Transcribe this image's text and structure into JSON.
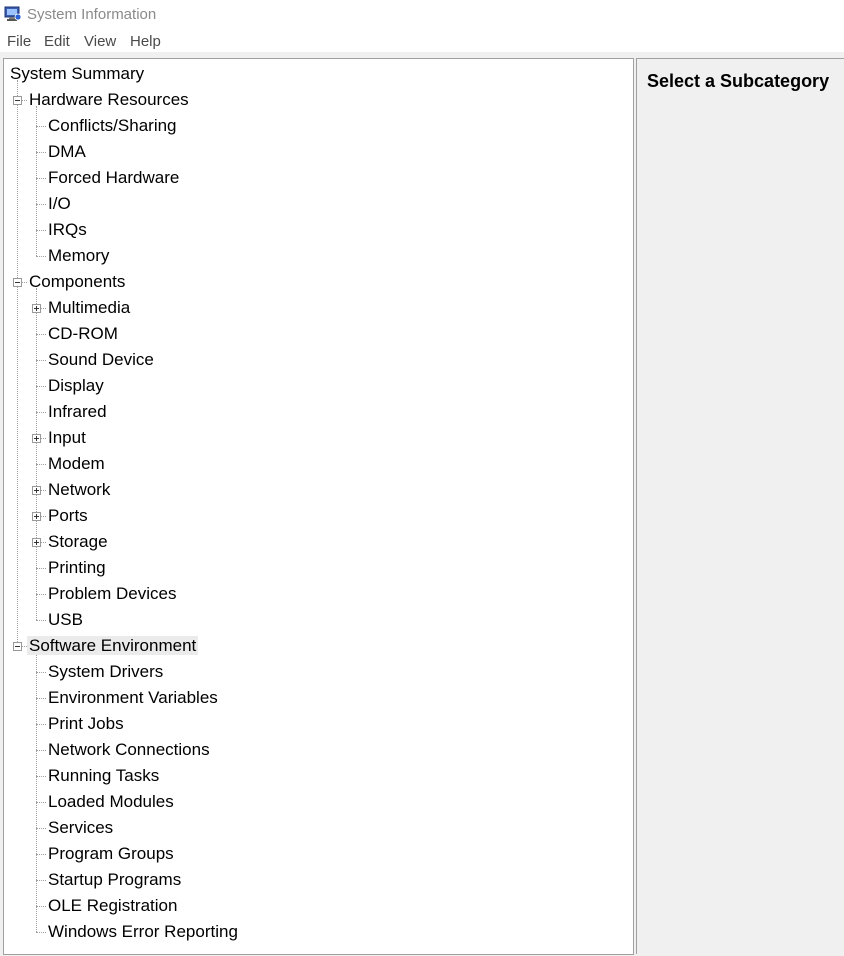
{
  "window": {
    "title": "System Information"
  },
  "menu": [
    "File",
    "Edit",
    "View",
    "Help"
  ],
  "tree": [
    {
      "label": "System Summary",
      "level": 0,
      "expander": ""
    },
    {
      "label": "Hardware Resources",
      "level": 1,
      "expander": "minus"
    },
    {
      "label": "Conflicts/Sharing",
      "level": 2,
      "expander": ""
    },
    {
      "label": "DMA",
      "level": 2,
      "expander": ""
    },
    {
      "label": "Forced Hardware",
      "level": 2,
      "expander": ""
    },
    {
      "label": "I/O",
      "level": 2,
      "expander": ""
    },
    {
      "label": "IRQs",
      "level": 2,
      "expander": ""
    },
    {
      "label": "Memory",
      "level": 2,
      "expander": ""
    },
    {
      "label": "Components",
      "level": 1,
      "expander": "minus"
    },
    {
      "label": "Multimedia",
      "level": 2,
      "expander": "plus"
    },
    {
      "label": "CD-ROM",
      "level": 2,
      "expander": ""
    },
    {
      "label": "Sound Device",
      "level": 2,
      "expander": ""
    },
    {
      "label": "Display",
      "level": 2,
      "expander": ""
    },
    {
      "label": "Infrared",
      "level": 2,
      "expander": ""
    },
    {
      "label": "Input",
      "level": 2,
      "expander": "plus"
    },
    {
      "label": "Modem",
      "level": 2,
      "expander": ""
    },
    {
      "label": "Network",
      "level": 2,
      "expander": "plus"
    },
    {
      "label": "Ports",
      "level": 2,
      "expander": "plus"
    },
    {
      "label": "Storage",
      "level": 2,
      "expander": "plus"
    },
    {
      "label": "Printing",
      "level": 2,
      "expander": ""
    },
    {
      "label": "Problem Devices",
      "level": 2,
      "expander": ""
    },
    {
      "label": "USB",
      "level": 2,
      "expander": ""
    },
    {
      "label": "Software Environment",
      "level": 1,
      "expander": "minus",
      "selected": true
    },
    {
      "label": "System Drivers",
      "level": 2,
      "expander": ""
    },
    {
      "label": "Environment Variables",
      "level": 2,
      "expander": ""
    },
    {
      "label": "Print Jobs",
      "level": 2,
      "expander": ""
    },
    {
      "label": "Network Connections",
      "level": 2,
      "expander": ""
    },
    {
      "label": "Running Tasks",
      "level": 2,
      "expander": ""
    },
    {
      "label": "Loaded Modules",
      "level": 2,
      "expander": ""
    },
    {
      "label": "Services",
      "level": 2,
      "expander": ""
    },
    {
      "label": "Program Groups",
      "level": 2,
      "expander": ""
    },
    {
      "label": "Startup Programs",
      "level": 2,
      "expander": ""
    },
    {
      "label": "OLE Registration",
      "level": 2,
      "expander": ""
    },
    {
      "label": "Windows Error Reporting",
      "level": 2,
      "expander": ""
    }
  ],
  "detail": {
    "heading": "Select a Subcategory"
  },
  "icons": {
    "app": "system-information-icon"
  }
}
